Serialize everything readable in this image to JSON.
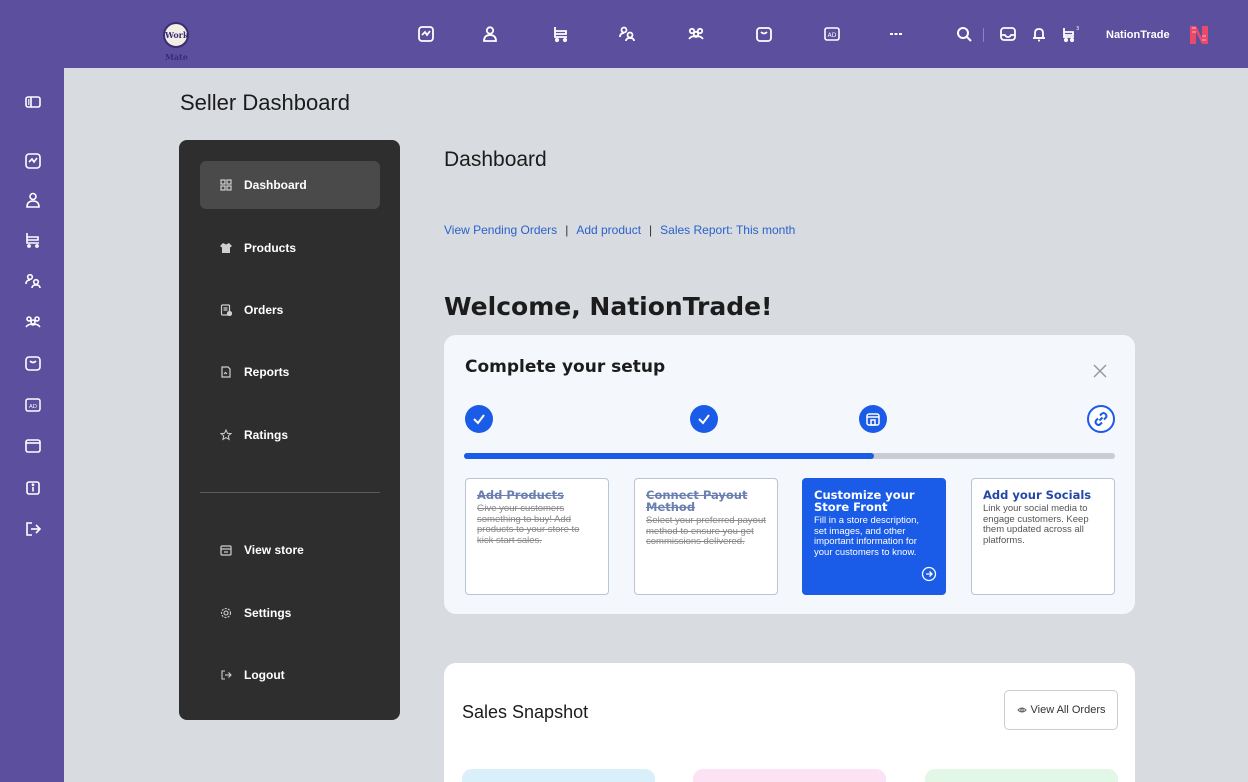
{
  "topbar": {
    "logo_text": "Work Mate",
    "brand_name": "NationTrade",
    "icons": [
      "dashboard-icon",
      "user-icon",
      "cart-icon",
      "users-icon",
      "group-icon",
      "store-icon",
      "ad-icon",
      "more-icon",
      "search-icon",
      "inbox-icon",
      "bell-icon",
      "cart-count-icon"
    ]
  },
  "rail": {
    "icons": [
      "sidebar-toggle-icon",
      "dashboard-icon",
      "user-icon",
      "cart-icon",
      "users-icon",
      "group-icon",
      "store-icon",
      "ad-icon",
      "window-icon",
      "info-icon",
      "logout-icon"
    ]
  },
  "page": {
    "heading": "Seller Dashboard",
    "dashboard_title": "Dashboard",
    "links": [
      "View Pending Orders",
      "Add product",
      "Sales Report: This month"
    ],
    "link_sep": "|",
    "welcome": "Welcome, NationTrade!"
  },
  "nav": {
    "items": [
      {
        "label": "Dashboard",
        "icon": "grid-icon"
      },
      {
        "label": "Products",
        "icon": "shirt-icon"
      },
      {
        "label": "Orders",
        "icon": "orders-icon"
      },
      {
        "label": "Reports",
        "icon": "report-icon"
      },
      {
        "label": "Ratings",
        "icon": "star-icon"
      },
      {
        "label": "View store",
        "icon": "store-icon"
      },
      {
        "label": "Settings",
        "icon": "gear-icon"
      },
      {
        "label": "Logout",
        "icon": "logout-icon"
      }
    ]
  },
  "setup": {
    "title": "Complete your setup",
    "progress": 0.63,
    "steps": [
      {
        "title": "Add Products",
        "desc": "Give your customers something to buy! Add products to your store to kick start sales.",
        "status": "done"
      },
      {
        "title": "Connect Payout Method",
        "desc": "Select your preferred payout method to ensure you get commissions delivered.",
        "status": "done"
      },
      {
        "title": "Customize your Store Front",
        "desc": "Fill in a store description, set images, and other important information for your customers to know.",
        "status": "current"
      },
      {
        "title": "Add your Socials",
        "desc": "Link your social media to engage customers. Keep them updated across all platforms.",
        "status": "todo"
      }
    ]
  },
  "sales": {
    "title": "Sales Snapshot",
    "view_all_label": "View All Orders",
    "tile_colors": [
      "#d9effa",
      "#fbe2f5",
      "#e3f7e6"
    ]
  },
  "colors": {
    "purple": "#5b4f9e",
    "accent_blue": "#1a5be8",
    "nav_dark": "#2e2e2e"
  }
}
